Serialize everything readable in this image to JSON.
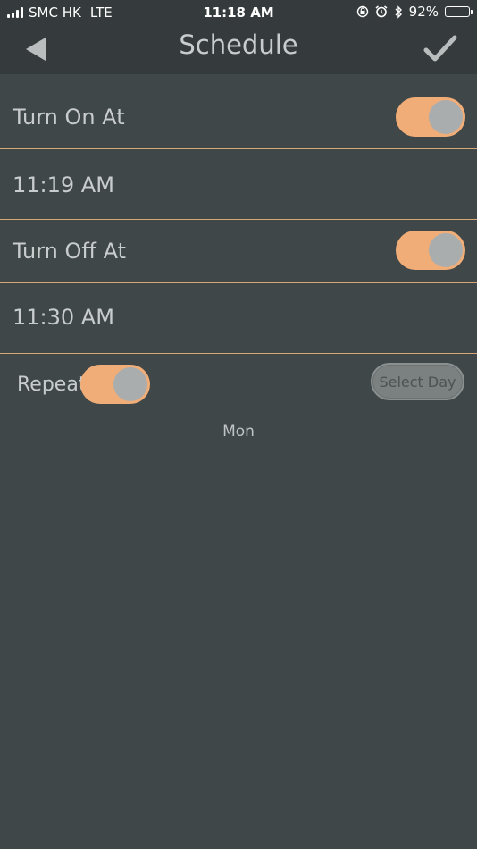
{
  "status_bar": {
    "carrier": "SMC HK",
    "network": "LTE",
    "time": "11:18 AM",
    "battery_percent": "92%",
    "battery_level": 0.92,
    "icons": [
      "signal-icon",
      "orientation-lock-icon",
      "alarm-icon",
      "bluetooth-icon",
      "battery-icon"
    ]
  },
  "nav": {
    "title": "Schedule",
    "back_icon": "back-arrow-icon",
    "confirm_icon": "checkmark-icon"
  },
  "schedule": {
    "turn_on": {
      "label": "Turn On At",
      "time": "11:19 AM",
      "enabled": true
    },
    "turn_off": {
      "label": "Turn Off At",
      "time": "11:30 AM",
      "enabled": true
    }
  },
  "repeat": {
    "label": "Repeat",
    "enabled": true,
    "select_day_label": "Select Day",
    "selected_days": "Mon"
  },
  "colors": {
    "background": "#3f4749",
    "header": "#353b3d",
    "accent": "#f0ad78",
    "divider": "#d6a777",
    "knob": "#a9adae"
  }
}
